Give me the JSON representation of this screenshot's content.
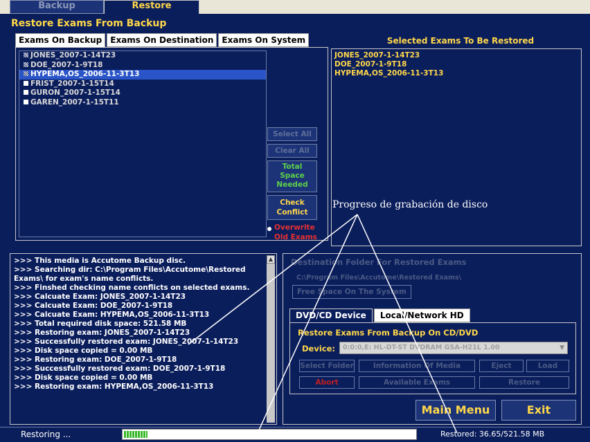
{
  "top_tabs": {
    "backup": "Backup",
    "restore": "Restore"
  },
  "section_title": "Restore Exams From Backup",
  "exam_tabs": [
    "Exams On Backup",
    "Exams On Destination",
    "Exams On System"
  ],
  "exams_on_backup": [
    {
      "label": "JONES_2007-1-14T23",
      "checked": true,
      "selected": false
    },
    {
      "label": "DOE_2007-1-9T18",
      "checked": true,
      "selected": false
    },
    {
      "label": "HYPEMA,OS_2006-11-3T13",
      "checked": true,
      "selected": true
    },
    {
      "label": "FRIST_2007-1-15T14",
      "checked": false,
      "selected": false
    },
    {
      "label": "GURON_2007-1-15T14",
      "checked": false,
      "selected": false
    },
    {
      "label": "GAREN_2007-1-15T11",
      "checked": false,
      "selected": false
    }
  ],
  "middle_buttons": {
    "select_all": "Select All",
    "clear_all": "Clear All",
    "total_space_line1": "Total",
    "total_space_line2": "Space",
    "total_space_line3": "Needed",
    "check_conflict_line1": "Check",
    "check_conflict_line2": "Conflict",
    "overwrite_line1": "Overwrite",
    "overwrite_line2": "Old Exams"
  },
  "selected_title": "Selected Exams To Be Restored",
  "selected_exams": [
    "JONES_2007-1-14T23",
    "DOE_2007-1-9T18",
    "HYPEMA,OS_2006-11-3T13"
  ],
  "log_lines": [
    ">>> This media is Accutome Backup disc.",
    ">>> Searching dir: C:\\Program Files\\Accutome\\Restored",
    "Exams\\ for exam's name conflicts.",
    ">>> Finshed checking name conflicts on selected exams.",
    ">>> Calcuate Exam: JONES_2007-1-14T23",
    ">>> Calcuate Exam: DOE_2007-1-9T18",
    ">>> Calcuate Exam: HYPEMA,OS_2006-11-3T13",
    ">>> Total required disk space: 521.58 MB",
    ">>> Restoring exam: JONES_2007-1-14T23",
    ">>> Successfully restored exam: JONES_2007-1-14T23",
    ">>> Disk space copied = 0.00 MB",
    ">>> Restoring exam: DOE_2007-1-9T18",
    ">>> Successfully restored exam: DOE_2007-1-9T18",
    ">>> Disk space copied = 0.00 MB",
    ">>> Restoring exam: HYPEMA,OS_2006-11-3T13"
  ],
  "destination": {
    "title": "Destination Folder For Restored Exams",
    "path": "C:\\Program Files\\Accutome\\Restored Exams\\",
    "free_space_button": "Free Space On The System"
  },
  "device_tabs": {
    "dvd": "DVD/CD Device",
    "local": "Local/Network HD"
  },
  "device_panel": {
    "title": "Restore Exams From Backup On CD/DVD",
    "device_label": "Device:",
    "device_value": "0:0:0,E: HL-DT-ST DVDRAM GSA-H21L 1.00",
    "select_folder": "Select Folder",
    "information_of_media": "Information Of Media",
    "eject": "Eject",
    "load": "Load",
    "abort": "Abort",
    "available_exams": "Available Exams",
    "restore": "Restore"
  },
  "main_menu": "Main Menu",
  "exit": "Exit",
  "status": {
    "text": "Restoring ...",
    "progress_fraction": 0.08,
    "restored_text": "Restored: 36.65/521.58 MB"
  },
  "annotation": "Progreso de grabación de disco",
  "colors": {
    "background": "#0b1e5c",
    "accent_yellow": "#ffd84a",
    "green": "#5ed04a",
    "red": "#e83030",
    "selection": "#2a55c8"
  }
}
